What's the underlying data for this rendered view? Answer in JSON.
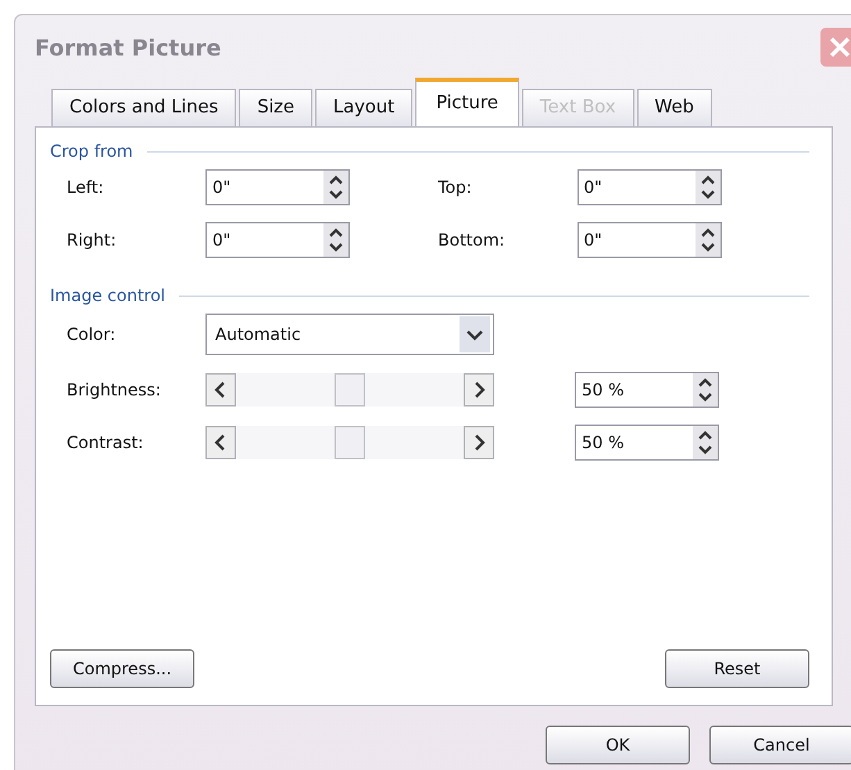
{
  "window": {
    "title": "Format Picture"
  },
  "tabs": [
    {
      "label": "Colors and Lines",
      "selected": false,
      "disabled": false
    },
    {
      "label": "Size",
      "selected": false,
      "disabled": false
    },
    {
      "label": "Layout",
      "selected": false,
      "disabled": false
    },
    {
      "label": "Picture",
      "selected": true,
      "disabled": false
    },
    {
      "label": "Text Box",
      "selected": false,
      "disabled": true
    },
    {
      "label": "Web",
      "selected": false,
      "disabled": false
    }
  ],
  "crop_from": {
    "title": "Crop from",
    "fields": [
      {
        "label": "Left:",
        "value": "0\""
      },
      {
        "label": "Top:",
        "value": "0\""
      },
      {
        "label": "Right:",
        "value": "0\""
      },
      {
        "label": "Bottom:",
        "value": "0\""
      }
    ]
  },
  "image_control": {
    "title": "Image control",
    "color": {
      "label": "Color:",
      "value": "Automatic"
    },
    "sliders": [
      {
        "label": "Brightness:",
        "level": 0.5,
        "reading": "50 %"
      },
      {
        "label": "Contrast:",
        "level": 0.5,
        "reading": "50 %"
      }
    ]
  },
  "panel_buttons": [
    "Compress...",
    "Reset"
  ],
  "buttons": [
    "OK",
    "Cancel"
  ]
}
